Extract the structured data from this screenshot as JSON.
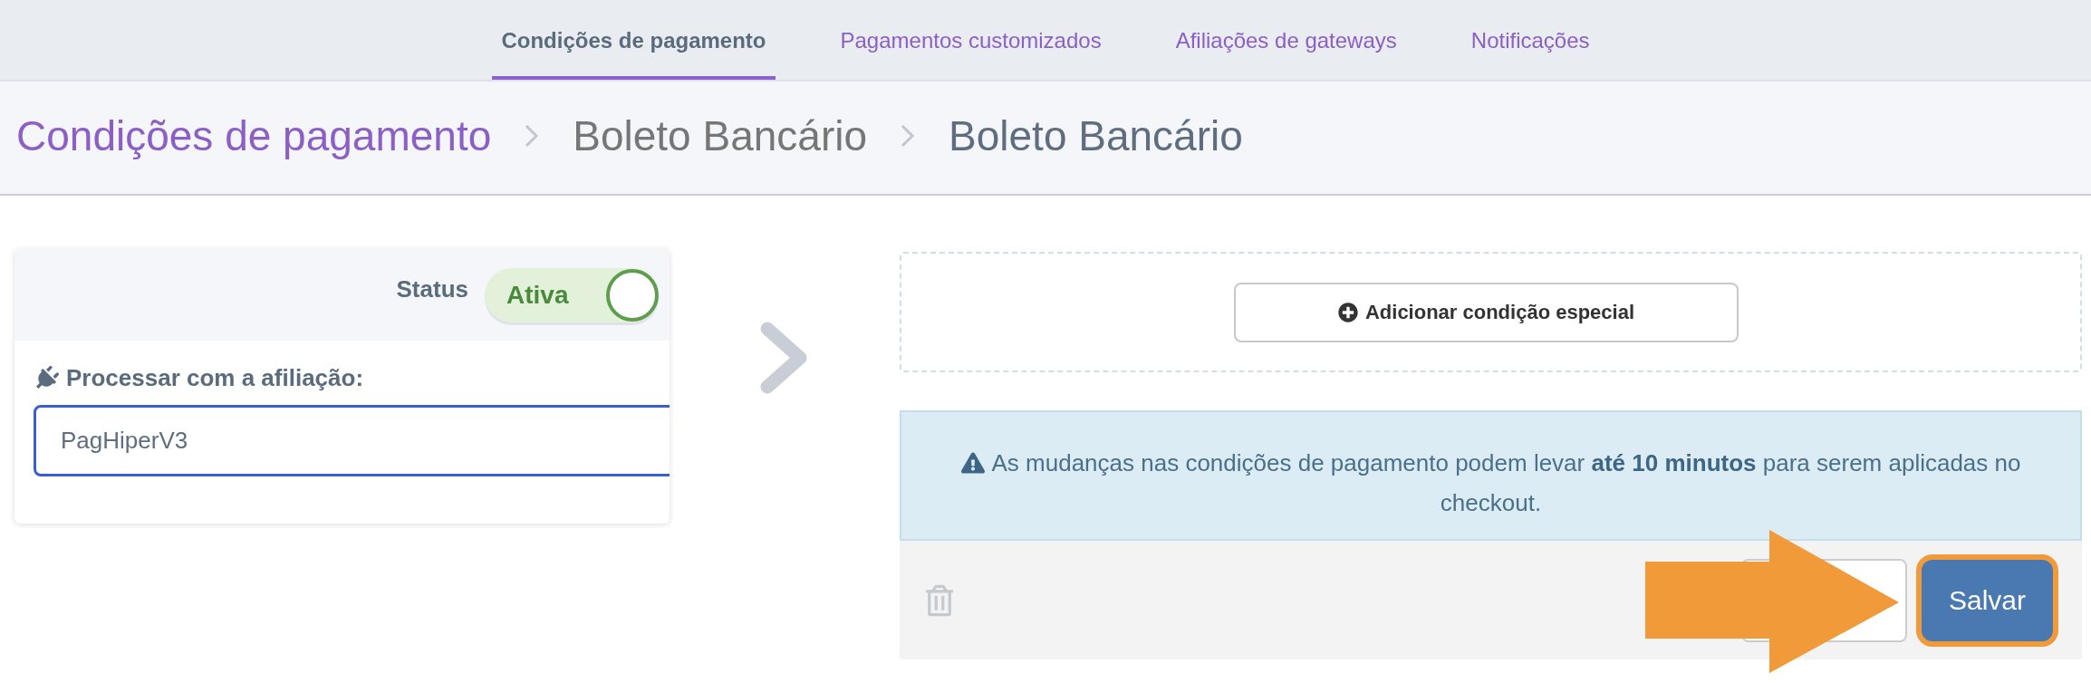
{
  "tabs": [
    {
      "label": "Condições de pagamento",
      "selected": true
    },
    {
      "label": "Pagamentos customizados",
      "selected": false
    },
    {
      "label": "Afiliações de gateways",
      "selected": false
    },
    {
      "label": "Notificações",
      "selected": false
    }
  ],
  "breadcrumb": [
    {
      "label": "Condições de pagamento",
      "kind": "link"
    },
    {
      "label": "Boleto Bancário",
      "kind": "text"
    },
    {
      "label": "Boleto Bancário",
      "kind": "current"
    }
  ],
  "status_card": {
    "status_label": "Status",
    "toggle": {
      "label": "Ativa",
      "on": true
    },
    "field": {
      "label": "Processar com a afiliação:",
      "value": "PagHiperV3"
    }
  },
  "special_condition": {
    "button": "Adicionar condição especial"
  },
  "alert": {
    "text": "As mudanças nas condições de pagamento podem levar **até 10 minutos** para serem aplicadas no checkout."
  },
  "footer": {
    "buttons": [
      {
        "kind": "secondary"
      },
      {
        "kind": "primary",
        "label": "Salvar",
        "highlighted": true
      }
    ]
  },
  "annotations": [
    {
      "kind": "arrow"
    }
  ]
}
